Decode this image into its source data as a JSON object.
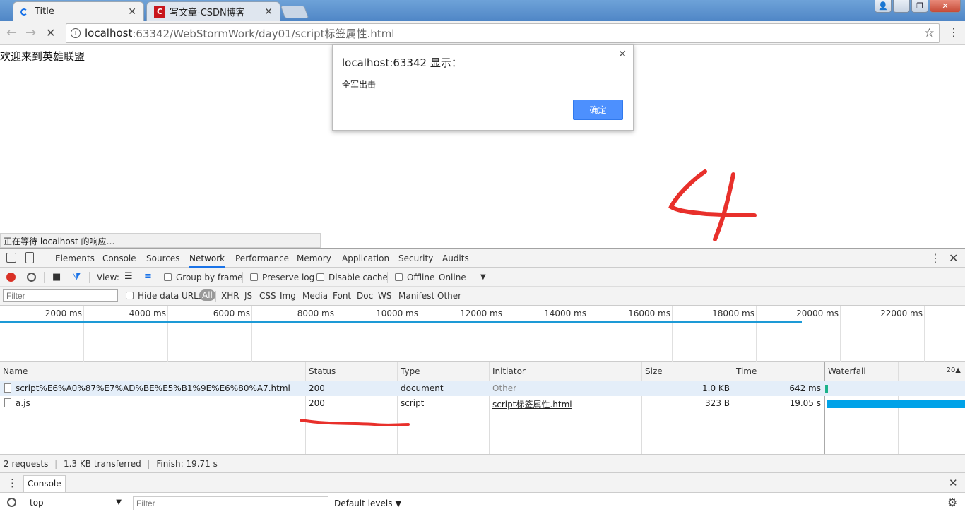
{
  "tabs": [
    {
      "title": "Title",
      "close": "✕"
    },
    {
      "title": "写文章-CSDN博客",
      "close": "✕"
    }
  ],
  "window": {
    "min": "−",
    "max": "❐",
    "close": "✕"
  },
  "toolbar": {
    "back": "←",
    "forward": "→",
    "reload": "✕",
    "url_host": "localhost",
    "url_path": ":63342/WebStormWork/day01/script标签属性.html",
    "star": "☆",
    "menu": "⋮",
    "info": "i"
  },
  "page": {
    "text": "欢迎来到英雄联盟",
    "status": "正在等待 localhost 的响应…",
    "annotation_color": "#e8302b"
  },
  "alert": {
    "title": "localhost:63342 显示：",
    "message": "全军出击",
    "ok": "确定",
    "close": "✕"
  },
  "devtools": {
    "tabs": [
      "Elements",
      "Console",
      "Sources",
      "Network",
      "Performance",
      "Memory",
      "Application",
      "Security",
      "Audits"
    ],
    "active_tab": "Network",
    "more": "⋮",
    "close": "✕",
    "controls": {
      "view": "View:",
      "group_by_frame": "Group by frame",
      "preserve_log": "Preserve log",
      "disable_cache": "Disable cache",
      "offline": "Offline",
      "throttle": "Online",
      "throttle_arrow": "▼"
    },
    "filter": {
      "placeholder": "Filter",
      "hide_data_urls": "Hide data URLs",
      "types": [
        "All",
        "XHR",
        "JS",
        "CSS",
        "Img",
        "Media",
        "Font",
        "Doc",
        "WS",
        "Manifest",
        "Other"
      ]
    },
    "overview_ticks": [
      "2000 ms",
      "4000 ms",
      "6000 ms",
      "8000 ms",
      "10000 ms",
      "12000 ms",
      "14000 ms",
      "16000 ms",
      "18000 ms",
      "20000 ms",
      "22000 ms"
    ],
    "columns": {
      "name": "Name",
      "status": "Status",
      "type": "Type",
      "initiator": "Initiator",
      "size": "Size",
      "time": "Time",
      "waterfall": "Waterfall",
      "waterfall_scale": "20▲"
    },
    "requests": [
      {
        "name": "script%E6%A0%87%E7%AD%BE%E5%B1%9E%E6%80%A7.html",
        "status": "200",
        "type": "document",
        "initiator": "Other",
        "size": "1.0 KB",
        "time": "642 ms"
      },
      {
        "name": "a.js",
        "status": "200",
        "type": "script",
        "initiator": "script标签属性.html",
        "size": "323 B",
        "time": "19.05 s"
      }
    ],
    "summary": {
      "requests": "2 requests",
      "transferred": "1.3 KB transferred",
      "finish": "Finish: 19.71 s",
      "sep": "|"
    },
    "drawer": {
      "tab": "Console",
      "context": "top",
      "context_arrow": "▼",
      "filter_placeholder": "Filter",
      "levels": "Default levels ▼",
      "more": "⋮",
      "close": "✕",
      "settings": "⚙"
    }
  }
}
